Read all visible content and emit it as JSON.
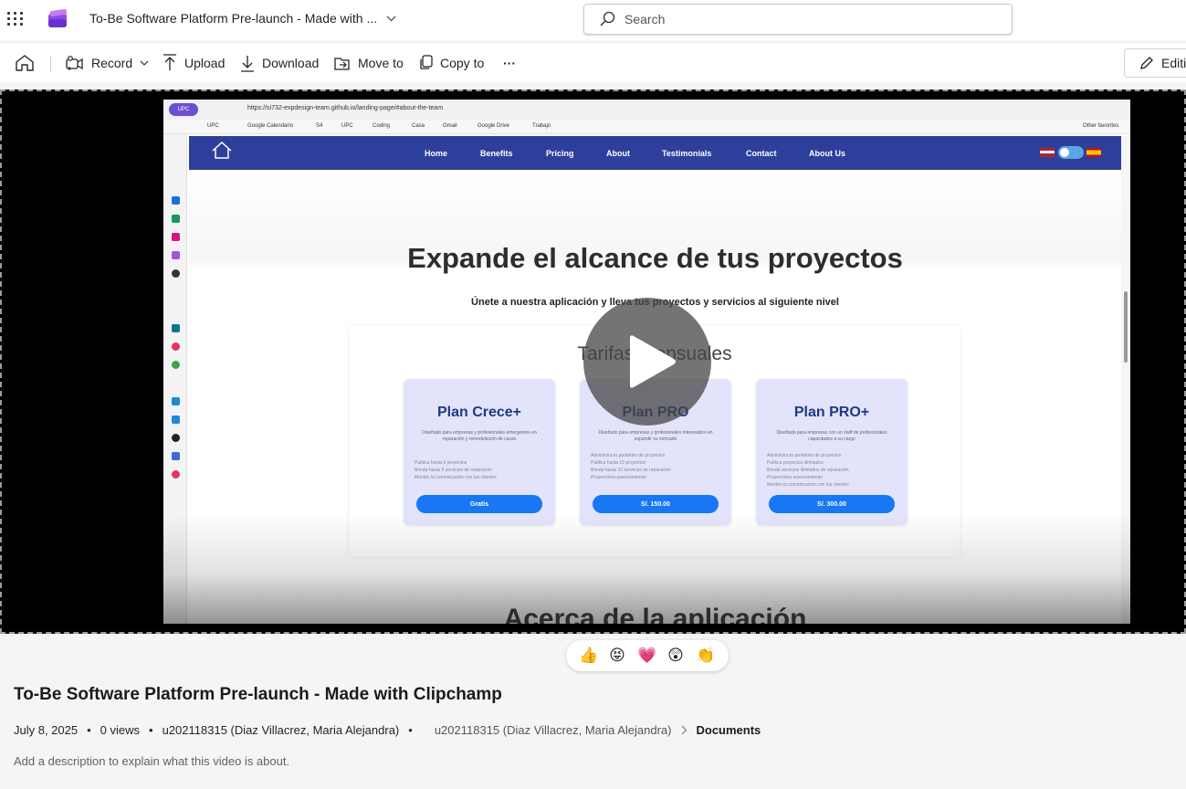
{
  "header": {
    "document_title": "To-Be Software Platform Pre-launch - Made with ...",
    "search_placeholder": "Search"
  },
  "toolbar": {
    "record": "Record",
    "upload": "Upload",
    "download": "Download",
    "move_to": "Move to",
    "copy_to": "Copy to",
    "more": "···",
    "edit": "Editi"
  },
  "video_frame": {
    "profile": "UPC",
    "url": "https://si732-expdesign-team.github.io/landing-page/#about-the-team",
    "bookmarks": [
      "UPC",
      "Google Calendario",
      "S4",
      "UPC",
      "Coding",
      "Casa",
      "Gmail",
      "Google Drive",
      "Trabajo"
    ],
    "other_favorites": "Other favorites",
    "nav_items": [
      "Home",
      "Benefits",
      "Pricing",
      "About",
      "Testimonials",
      "Contact",
      "About Us"
    ],
    "heading": "Expande el alcance de tus proyectos",
    "subheading": "Únete a nuestra aplicación y lleva tus proyectos y servicios al siguiente nivel",
    "pricing_title": "Tarifas Mensuales",
    "plans": [
      {
        "name": "Plan Crece+",
        "description": "Diseñado para empresas y profesionales emergentes en reparación y remodelación de casas",
        "features": [
          "Publica hasta 5 proyectos",
          "Brinda hasta 5 servicios de reparación",
          "Mantén la comunicación con tus clientes"
        ],
        "price": "Gratis"
      },
      {
        "name": "Plan PRO",
        "description": "Diseñado para empresas y profesionales interesados en expandir su mercado",
        "features": [
          "Administra tu portafolio de proyectos",
          "Publica hasta 15 proyectos",
          "Brinda hasta 10 servicios de reparación",
          "Proporciona asesoramiento"
        ],
        "price": "S/. 150.00"
      },
      {
        "name": "Plan PRO+",
        "description": "Diseñado para empresas con un staff de profesionales capacitados a su cargo",
        "features": [
          "Administra tu portafolio de proyectos",
          "Publica proyectos ilimitados",
          "Brinda servicios ilimitados de reparación",
          "Proporciona asesoramiento",
          "Mantén la comunicación con tus clientes"
        ],
        "price": "S/. 300.00"
      }
    ],
    "next_section": "Acerca de la aplicación"
  },
  "reactions": [
    "👍",
    "😝",
    "💗",
    "😲",
    "👏"
  ],
  "details": {
    "title": "To-Be Software Platform Pre-launch - Made with Clipchamp",
    "date": "July 8, 2025",
    "views": "0 views",
    "owner": "u202118315 (Diaz Villacrez, Maria Alejandra)",
    "location_owner": "u202118315 (Diaz Villacrez, Maria Alejandra)",
    "location_folder": "Documents",
    "description_placeholder": "Add a description to explain what this video is about."
  },
  "colors": {
    "nav_bg": "#2e3f9b",
    "plan_button": "#1877f2",
    "card_bg": "#e3e3fb",
    "brand_purple": "#7b3fd6"
  },
  "icons": [
    "waffle-icon",
    "clipchamp-logo-icon",
    "search-icon",
    "home-icon",
    "record-icon",
    "upload-icon",
    "download-icon",
    "move-to-icon",
    "copy-to-icon",
    "edit-icon",
    "play-icon"
  ]
}
